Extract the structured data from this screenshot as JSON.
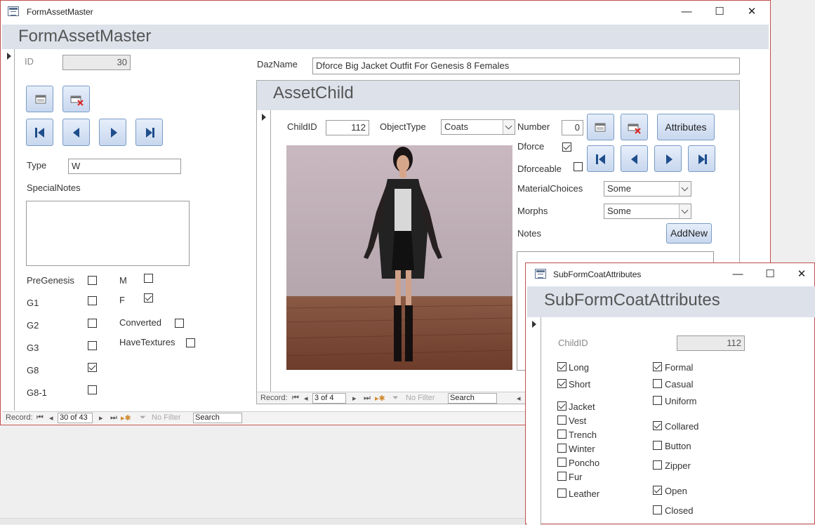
{
  "main_window": {
    "title": "FormAssetMaster",
    "header": "FormAssetMaster",
    "id_label": "ID",
    "id_value": "30",
    "type_label": "Type",
    "type_value": "W",
    "special_notes_label": "SpecialNotes",
    "dazname_label": "DazName",
    "dazname_value": "Dforce Big Jacket Outfit For Genesis 8 Females",
    "checks_left": [
      {
        "label": "PreGenesis",
        "checked": false
      },
      {
        "label": "G1",
        "checked": false
      },
      {
        "label": "G2",
        "checked": false
      },
      {
        "label": "G3",
        "checked": false
      },
      {
        "label": "G8",
        "checked": true
      },
      {
        "label": "G8-1",
        "checked": false
      }
    ],
    "checks_right": [
      {
        "label": "M",
        "checked": false
      },
      {
        "label": "F",
        "checked": true
      },
      {
        "label": "Converted",
        "checked": false
      },
      {
        "label": "HaveTextures",
        "checked": false
      }
    ],
    "record_nav": {
      "label": "Record:",
      "position": "30 of 43",
      "filter": "No Filter",
      "search": "Search"
    }
  },
  "asset_child": {
    "header": "AssetChild",
    "childid_label": "ChildID",
    "childid_value": "112",
    "objecttype_label": "ObjectType",
    "objecttype_value": "Coats",
    "number_label": "Number",
    "number_value": "0",
    "attributes_button": "Attributes",
    "dforce_label": "Dforce",
    "dforce_checked": true,
    "dforceable_label": "Dforceable",
    "dforceable_checked": false,
    "material_label": "MaterialChoices",
    "material_value": "Some",
    "morphs_label": "Morphs",
    "morphs_value": "Some",
    "notes_label": "Notes",
    "addnew_button": "AddNew",
    "record_nav": {
      "label": "Record:",
      "position": "3 of 4",
      "filter": "No Filter",
      "search": "Search"
    }
  },
  "sub_window": {
    "title": "SubFormCoatAttributes",
    "header": "SubFormCoatAttributes",
    "childid_label": "ChildID",
    "childid_value": "112",
    "left_checks": [
      {
        "label": "Long",
        "checked": true
      },
      {
        "label": "Short",
        "checked": true
      },
      {
        "label": "Jacket",
        "checked": true
      },
      {
        "label": "Vest",
        "checked": false
      },
      {
        "label": "Trench",
        "checked": false
      },
      {
        "label": "Winter",
        "checked": false
      },
      {
        "label": "Poncho",
        "checked": false
      },
      {
        "label": "Fur",
        "checked": false
      },
      {
        "label": "Leather",
        "checked": false
      }
    ],
    "right_checks": [
      {
        "label": "Formal",
        "checked": true
      },
      {
        "label": "Casual",
        "checked": false
      },
      {
        "label": "Uniform",
        "checked": false
      },
      {
        "label": "Collared",
        "checked": true
      },
      {
        "label": "Button",
        "checked": false
      },
      {
        "label": "Zipper",
        "checked": false
      },
      {
        "label": "Open",
        "checked": true
      },
      {
        "label": "Closed",
        "checked": false
      }
    ]
  },
  "window_controls": {
    "minimize": "—",
    "maximize": "☐",
    "close": "✕"
  }
}
